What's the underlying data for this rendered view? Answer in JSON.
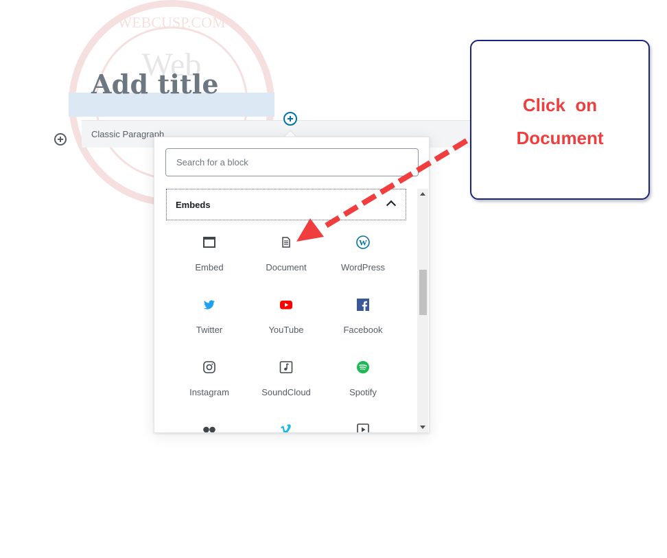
{
  "watermark": {
    "text": "WEBCUSP.COM",
    "word": "Web"
  },
  "editor": {
    "title_placeholder": "Add title",
    "classic_block_label": "Classic Paragraph"
  },
  "inserter": {
    "search_placeholder": "Search for a block",
    "panel_title": "Embeds",
    "items": [
      {
        "label": "Embed",
        "icon": "embed-icon"
      },
      {
        "label": "Document",
        "icon": "document-icon"
      },
      {
        "label": "WordPress",
        "icon": "wordpress-icon"
      },
      {
        "label": "Twitter",
        "icon": "twitter-icon"
      },
      {
        "label": "YouTube",
        "icon": "youtube-icon"
      },
      {
        "label": "Facebook",
        "icon": "facebook-icon"
      },
      {
        "label": "Instagram",
        "icon": "instagram-icon"
      },
      {
        "label": "SoundCloud",
        "icon": "soundcloud-icon"
      },
      {
        "label": "Spotify",
        "icon": "spotify-icon"
      }
    ]
  },
  "annotation": {
    "line1": "Click  on",
    "line2": "Document"
  },
  "colors": {
    "accent": "#0073aa",
    "annotation_red": "#f03e3e",
    "callout_border": "#1a237e",
    "twitter": "#1da1f2",
    "youtube": "#ff0000",
    "facebook": "#3b5998",
    "spotify": "#1db954",
    "vimeo": "#1ab7ea"
  }
}
